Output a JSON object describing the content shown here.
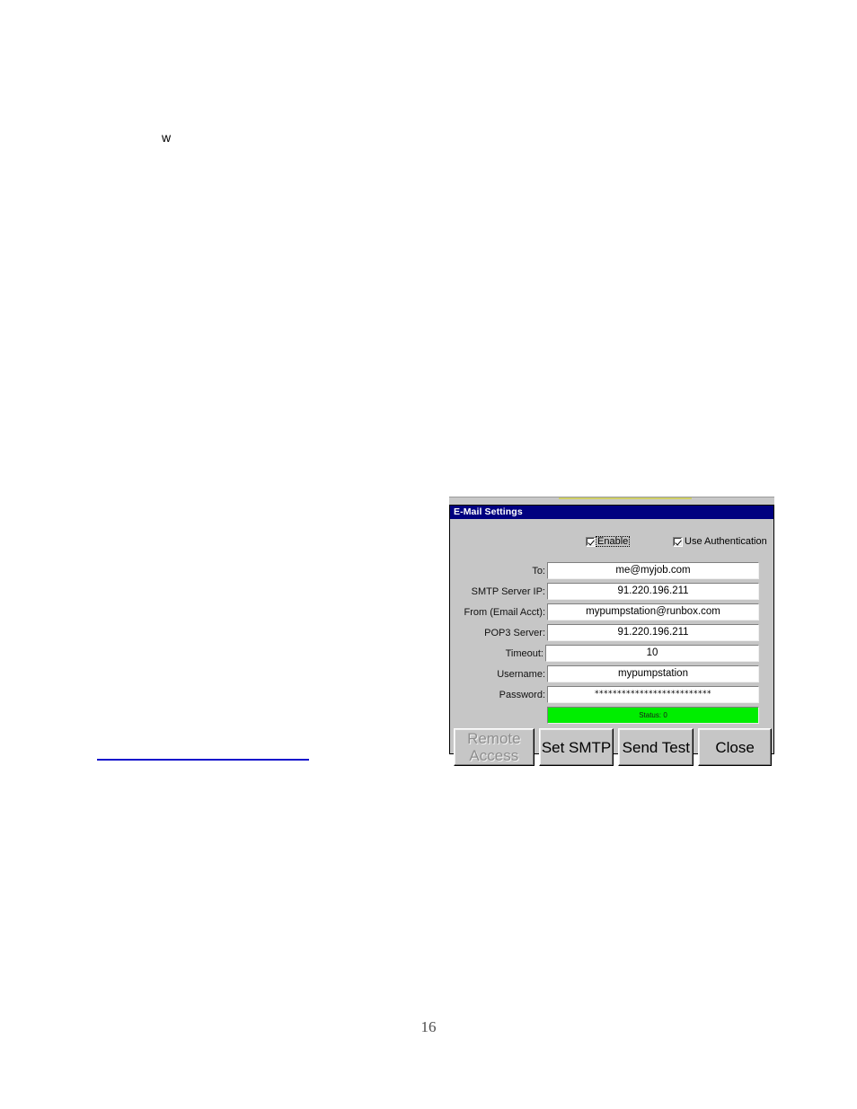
{
  "document": {
    "stray_letter": "w",
    "page_number": "16"
  },
  "dialog": {
    "title": "E-Mail Settings",
    "colors": {
      "titlebar": "#000080",
      "titlebar_text": "#ffffff",
      "face": "#c6c6c6",
      "status_ok": "#00ee00",
      "link_rule": "#1111cc"
    },
    "checkboxes": [
      {
        "name": "enable",
        "label": "Enable",
        "checked": true,
        "focused": true
      },
      {
        "name": "use_authentication",
        "label": "Use Authentication",
        "checked": true,
        "focused": false
      }
    ],
    "fields": [
      {
        "name": "to",
        "label": "To:",
        "value": "me@myjob.com"
      },
      {
        "name": "smtp_server_ip",
        "label": "SMTP Server IP:",
        "value": "91.220.196.211"
      },
      {
        "name": "from",
        "label": "From (Email Acct):",
        "value": "mypumpstation@runbox.com"
      },
      {
        "name": "pop3_server",
        "label": "POP3 Server:",
        "value": "91.220.196.211"
      },
      {
        "name": "timeout",
        "label": "Timeout:",
        "value": "10"
      },
      {
        "name": "username",
        "label": "Username:",
        "value": "mypumpstation"
      },
      {
        "name": "password",
        "label": "Password:",
        "value": "**************************"
      }
    ],
    "status": {
      "label": "Status: 0"
    },
    "buttons": [
      {
        "name": "remote_access",
        "line1": "Remote",
        "line2": "Access",
        "disabled": true
      },
      {
        "name": "set_smtp",
        "line1": "Set SMTP",
        "line2": "",
        "disabled": false
      },
      {
        "name": "send_test",
        "line1": "Send Test",
        "line2": "",
        "disabled": false
      },
      {
        "name": "close",
        "line1": "Close",
        "line2": "",
        "disabled": false
      }
    ]
  }
}
